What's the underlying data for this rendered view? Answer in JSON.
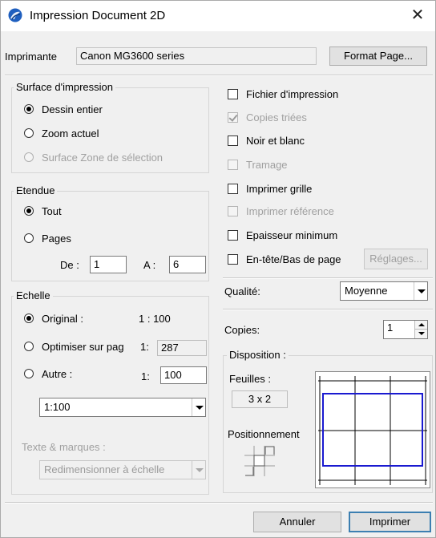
{
  "window": {
    "title": "Impression Document 2D",
    "close_glyph": "✕"
  },
  "printer": {
    "label": "Imprimante",
    "value": "Canon MG3600 series",
    "format_button": "Format Page..."
  },
  "surface": {
    "title": "Surface d'impression",
    "options": [
      {
        "label": "Dessin entier",
        "selected": true,
        "enabled": true
      },
      {
        "label": "Zoom actuel",
        "selected": false,
        "enabled": true
      },
      {
        "label": "Surface Zone de sélection",
        "selected": false,
        "enabled": false
      }
    ]
  },
  "etendue": {
    "title": "Etendue",
    "options": [
      {
        "label": "Tout",
        "selected": true
      },
      {
        "label": "Pages",
        "selected": false
      }
    ],
    "from_label": "De :",
    "from_value": "1",
    "to_label": "A :",
    "to_value": "6"
  },
  "echelle": {
    "title": "Echelle",
    "original_label": "Original :",
    "original_value": "1 : 100",
    "optimiser_label": "Optimiser sur pag",
    "optimiser_prefix": "1:",
    "optimiser_value": "287",
    "autre_label": "Autre :",
    "autre_prefix": "1:",
    "autre_value": "100",
    "scale_select": "1:100",
    "texte_label": "Texte & marques :",
    "texte_select": "Redimensionner à échelle"
  },
  "checks": [
    {
      "label": "Fichier d'impression",
      "checked": false,
      "enabled": true
    },
    {
      "label": "Copies triées",
      "checked": true,
      "enabled": false
    },
    {
      "label": "Noir et blanc",
      "checked": false,
      "enabled": true
    },
    {
      "label": "Tramage",
      "checked": false,
      "enabled": false
    },
    {
      "label": "Imprimer grille",
      "checked": false,
      "enabled": true
    },
    {
      "label": "Imprimer référence",
      "checked": false,
      "enabled": false
    },
    {
      "label": "Epaisseur minimum",
      "checked": false,
      "enabled": true
    },
    {
      "label": "En-tête/Bas de page",
      "checked": false,
      "enabled": true
    }
  ],
  "reglages_button": "Réglages...",
  "quality": {
    "label": "Qualité:",
    "value": "Moyenne"
  },
  "copies": {
    "label": "Copies:",
    "value": "1"
  },
  "disposition": {
    "title": "Disposition :",
    "feuilles_label": "Feuilles :",
    "feuilles_value": "3 x 2",
    "positionnement_label": "Positionnement",
    "grid_columns": 3,
    "grid_rows": 2,
    "accent_color": "#1a1ad0"
  },
  "footer": {
    "cancel": "Annuler",
    "print": "Imprimer"
  },
  "colors": {
    "logo": "#1f5fbf",
    "disabled_text": "#a0a0a0"
  }
}
